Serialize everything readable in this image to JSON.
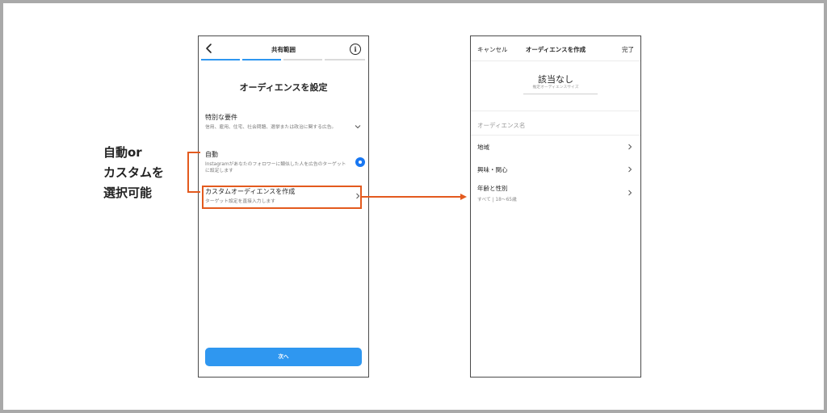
{
  "annotation": {
    "lines": [
      "自動or",
      "カスタムを",
      "選択可能"
    ],
    "accent_color": "#e35a1e"
  },
  "left_screen": {
    "title": "共有範囲",
    "progress_steps_complete": 2,
    "progress_steps_total": 4,
    "heading": "オーディエンスを設定",
    "options": [
      {
        "title": "特別な要件",
        "description": "信用、雇用、住宅、社会問題、選挙または政治に関する広告。",
        "control": "chevron-down"
      },
      {
        "title": "自動",
        "description": "Instagramがあなたのフォロワーに類似した人を広告のターゲットに設定します",
        "control": "radio-selected"
      },
      {
        "title": "カスタムオーディエンスを作成",
        "description": "ターゲット設定を直接入力します",
        "control": "chevron-right"
      }
    ],
    "next_button": "次へ",
    "accent_color": "#2f97f0"
  },
  "right_screen": {
    "cancel": "キャンセル",
    "title": "オーディエンスを作成",
    "done": "完了",
    "audience_size_value": "該当なし",
    "audience_size_label": "推定オーディエンスサイズ",
    "name_placeholder": "オーディエンス名",
    "rows": [
      {
        "label": "地域",
        "sub": ""
      },
      {
        "label": "興味・関心",
        "sub": ""
      },
      {
        "label": "年齢と性別",
        "sub": "すべて | 18〜65歳"
      }
    ]
  }
}
